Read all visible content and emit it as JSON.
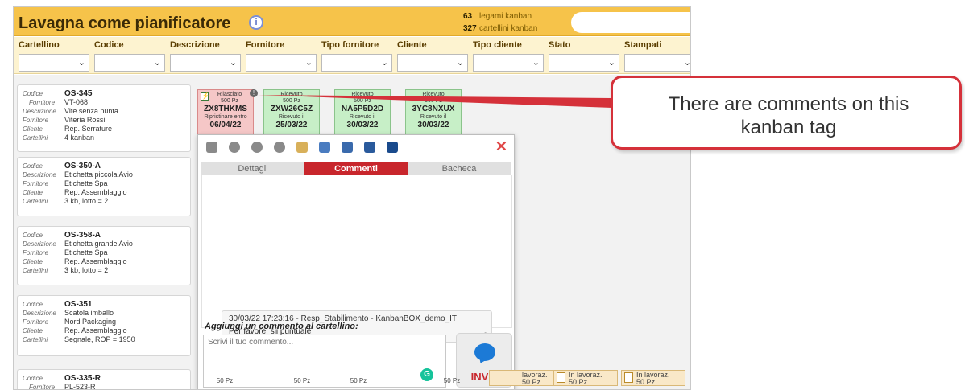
{
  "header": {
    "title": "Lavagna come pianificatore",
    "info_icon": "i",
    "counts": [
      {
        "num": "63",
        "label": "legami kanban"
      },
      {
        "num": "327",
        "label": "cartellini kanban"
      }
    ]
  },
  "filters": [
    "Cartellino",
    "Codice",
    "Descrizione",
    "Fornitore",
    "Tipo fornitore",
    "Cliente",
    "Tipo cliente",
    "Stato",
    "Stampati"
  ],
  "cards": [
    {
      "rows": [
        [
          "Codice",
          "OS-345"
        ],
        [
          "Fornitore",
          "VT-068"
        ],
        [
          "Descrizione",
          "Vite senza punta"
        ],
        [
          "Fornitore",
          "Viteria Rossi"
        ],
        [
          "Cliente",
          "Rep. Serrature"
        ],
        [
          "Cartellini",
          "4 kanban"
        ]
      ]
    },
    {
      "rows": [
        [
          "Codice",
          "OS-350-A"
        ],
        [
          "Descrizione",
          "Etichetta piccola Avio"
        ],
        [
          "Fornitore",
          "Etichette Spa"
        ],
        [
          "Cliente",
          "Rep. Assemblaggio"
        ],
        [
          "Cartellini",
          "3 kb, lotto = 2"
        ]
      ]
    },
    {
      "rows": [
        [
          "Codice",
          "OS-358-A"
        ],
        [
          "Descrizione",
          "Etichetta grande Avio"
        ],
        [
          "Fornitore",
          "Etichette Spa"
        ],
        [
          "Cliente",
          "Rep. Assemblaggio"
        ],
        [
          "Cartellini",
          "3 kb, lotto = 2"
        ]
      ]
    },
    {
      "rows": [
        [
          "Codice",
          "OS-351"
        ],
        [
          "Descrizione",
          "Scatola imballo"
        ],
        [
          "Fornitore",
          "Nord Packaging"
        ],
        [
          "Cliente",
          "Rep. Assemblaggio"
        ],
        [
          "Cartellini",
          "Segnale, ROP = 1950"
        ]
      ]
    },
    {
      "rows": [
        [
          "Codice",
          "OS-335-R"
        ],
        [
          "Fornitore",
          "PL-523-R"
        ]
      ]
    }
  ],
  "tags": [
    {
      "status": "Rilasciato",
      "qty": "500 Pz",
      "note": "Ripristinare entro",
      "code": "ZX8THKMS",
      "date": "06/04/22"
    },
    {
      "status": "Ricevuto",
      "qty": "500 Pz",
      "note": "Ricevuto il",
      "code": "ZXW26C5Z",
      "date": "25/03/22"
    },
    {
      "status": "Ricevuto",
      "qty": "500 Pz",
      "note": "Ricevuto il",
      "code": "NA5P5D2D",
      "date": "30/03/22"
    },
    {
      "status": "Ricevuto",
      "qty": "500 Pz",
      "note": "Ricevuto il",
      "code": "3YC8NXUX",
      "date": "30/03/22"
    }
  ],
  "popup": {
    "tabs": [
      "Dettagli",
      "Commenti",
      "Bacheca"
    ],
    "active_tab": "Commenti",
    "close": "✕",
    "comment": {
      "meta": "30/03/22 17:23:16 - Resp_Stabilimento - KanbanBOX_demo_IT",
      "text": "Per favore, sii puntuale"
    },
    "add_label": "Aggiungi un commento al cartellino:",
    "input_placeholder": "Scrivi il tuo commento...",
    "send_label": "INVIA",
    "grammarly": "G"
  },
  "bottom": {
    "qty": "50 Pz",
    "in_lavoraz": "In lavoraz.",
    "lavoraz_short": "lavoraz."
  },
  "callout": {
    "line1": "There are comments on this",
    "line2": "kanban tag"
  },
  "colors": {
    "header": "#f6c34a",
    "active_tab": "#c8262c",
    "callout_border": "#d5313a"
  }
}
